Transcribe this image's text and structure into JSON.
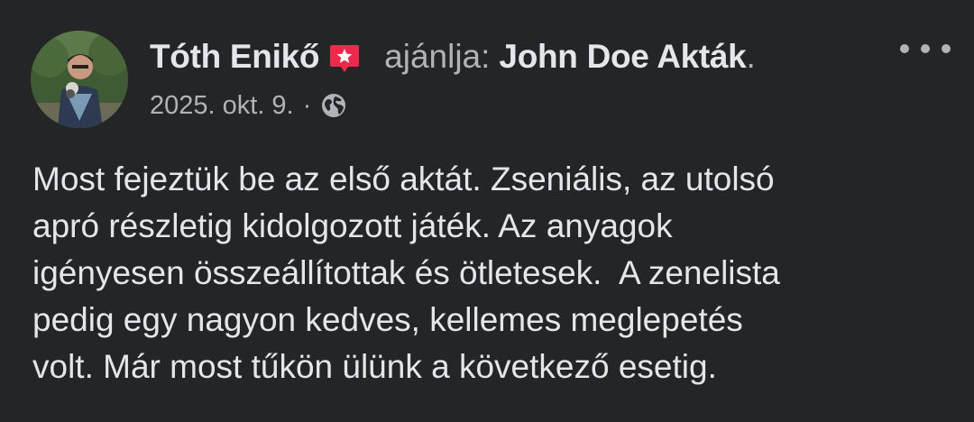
{
  "post": {
    "author": {
      "name": "Tóth Enikő",
      "avatar_icon": "profile-photo",
      "badge_icon": "star-badge-icon",
      "badge_color": "#f02849"
    },
    "recommends_text": "ajánlja:",
    "page_name": "John Doe Akták",
    "period": ".",
    "more_icon": "more-dots-icon",
    "meta": {
      "date": "2025. okt. 9.",
      "separator": "·",
      "privacy_icon": "globe-icon"
    },
    "body_lines": [
      "Most fejeztük be az első aktát. Zseniális, az utolsó",
      "apró részletig kidolgozott játék. Az anyagok",
      "igényesen összeállítottak és ötletesek.  A zenelista",
      "pedig egy nagyon kedves, kellemes meglepetés",
      "volt. Már most tűkön ülünk a következő esetig."
    ]
  },
  "colors": {
    "background": "#242526",
    "primary_text": "#e4e6eb",
    "secondary_text": "#b0b3b8"
  }
}
